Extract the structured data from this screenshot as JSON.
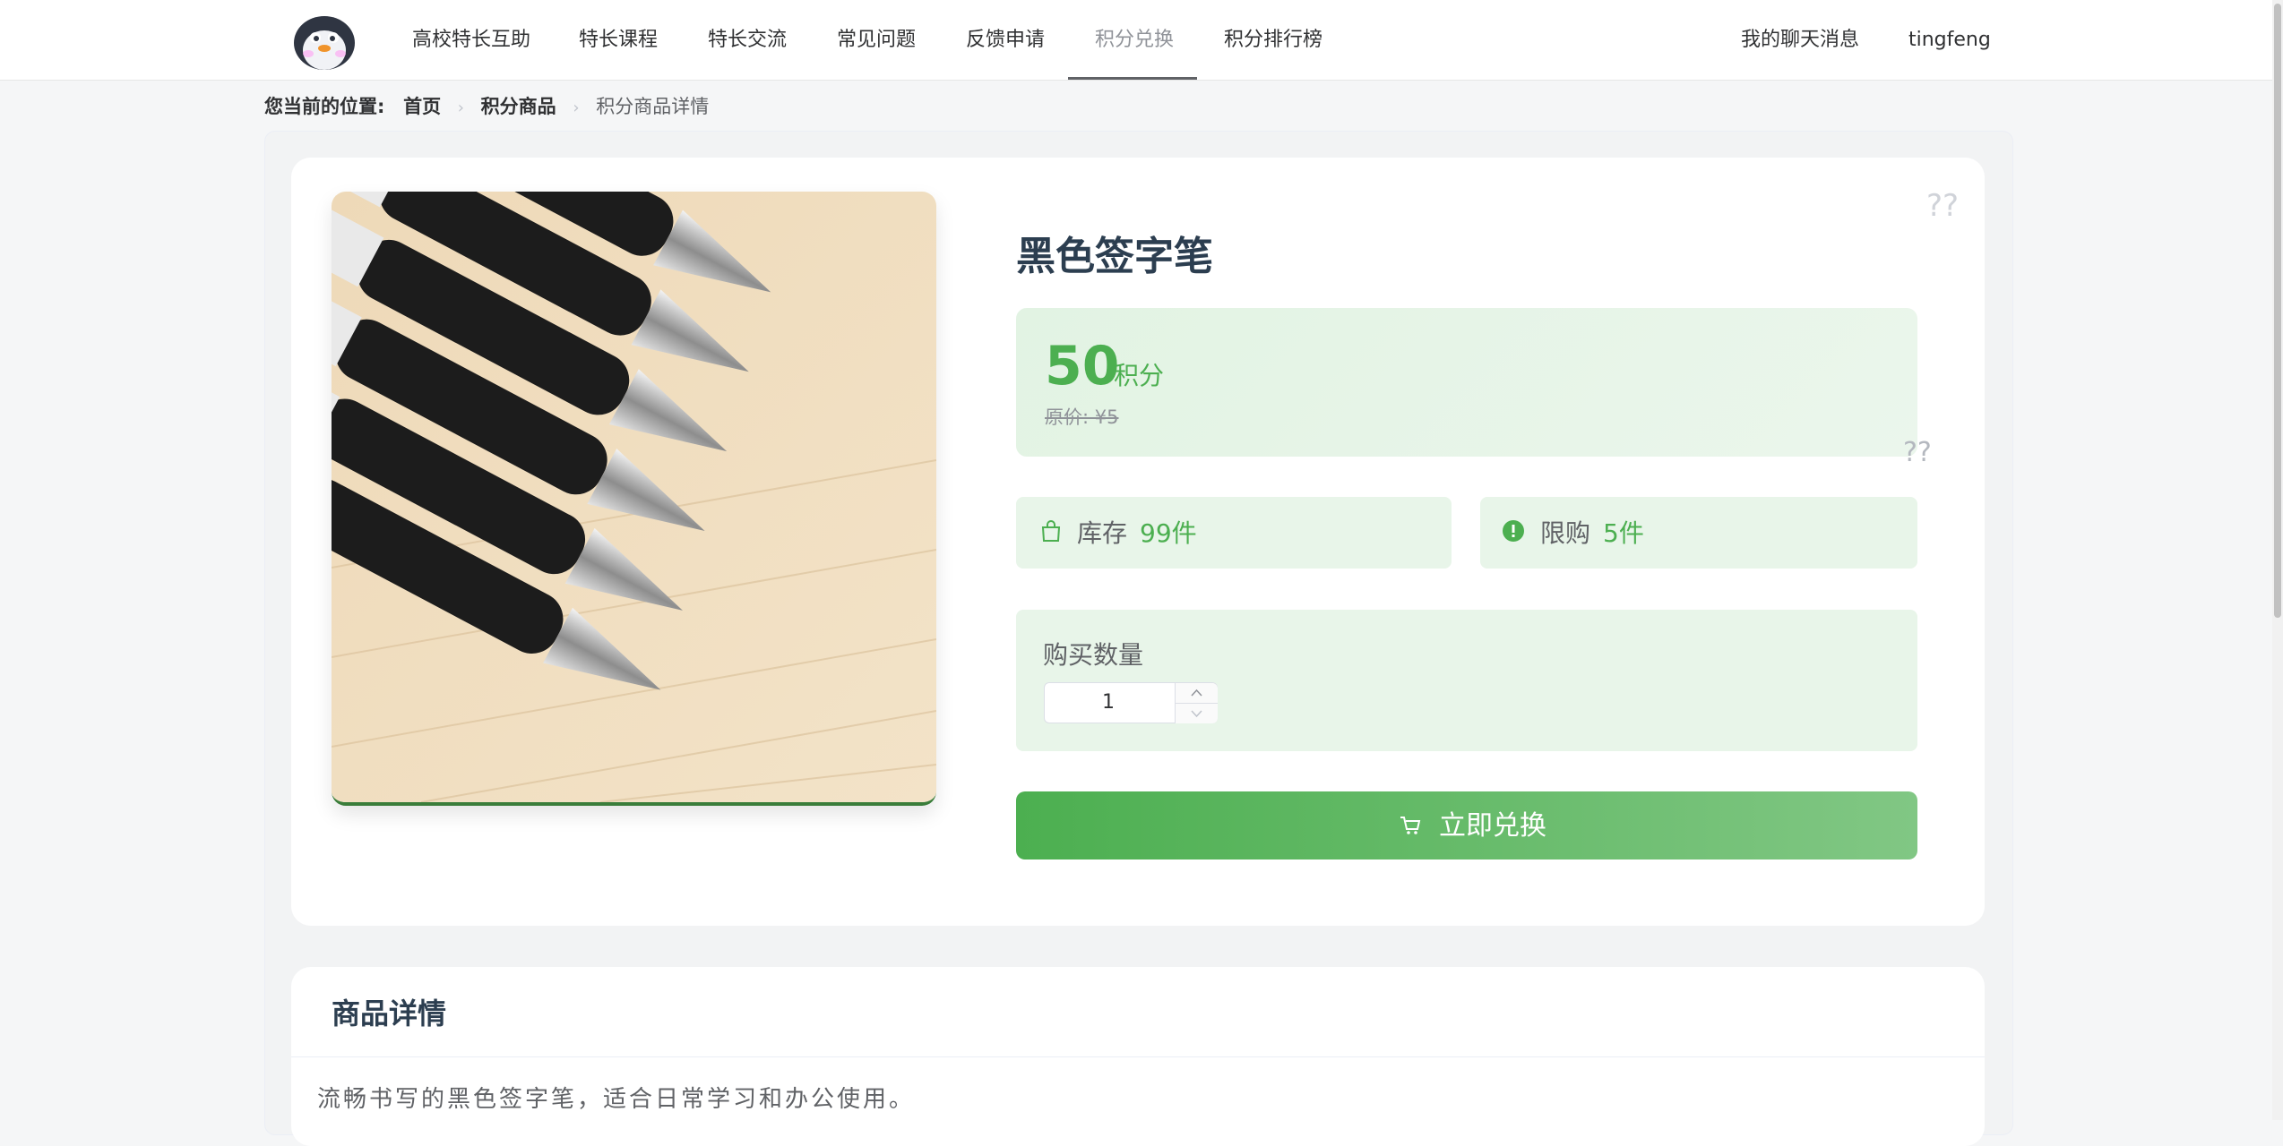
{
  "nav": {
    "items": [
      "高校特长互助",
      "特长课程",
      "特长交流",
      "常见问题",
      "反馈申请",
      "积分兑换",
      "积分排行榜"
    ],
    "active": "积分兑换",
    "messages_label": "我的聊天消息",
    "username": "tingfeng"
  },
  "breadcrumb": {
    "prefix": "您当前的位置:",
    "home": "首页",
    "category": "积分商品",
    "current": "积分商品详情"
  },
  "product": {
    "title": "黑色签字笔",
    "points": "50",
    "points_unit": "积分",
    "original_price": "原价: ¥5",
    "stock_label": "库存",
    "stock_value": "99件",
    "limit_label": "限购",
    "limit_value": "5件",
    "quantity_label": "购买数量",
    "quantity_value": "1",
    "exchange_button": "立即兑换",
    "placeholder_top": "??",
    "placeholder_price": "??"
  },
  "detail": {
    "title": "商品详情",
    "description": "流畅书写的黑色签字笔，适合日常学习和办公使用。"
  },
  "colors": {
    "accent": "#4caf50",
    "accent_light": "#e8f5e9",
    "title": "#2c3e50"
  }
}
